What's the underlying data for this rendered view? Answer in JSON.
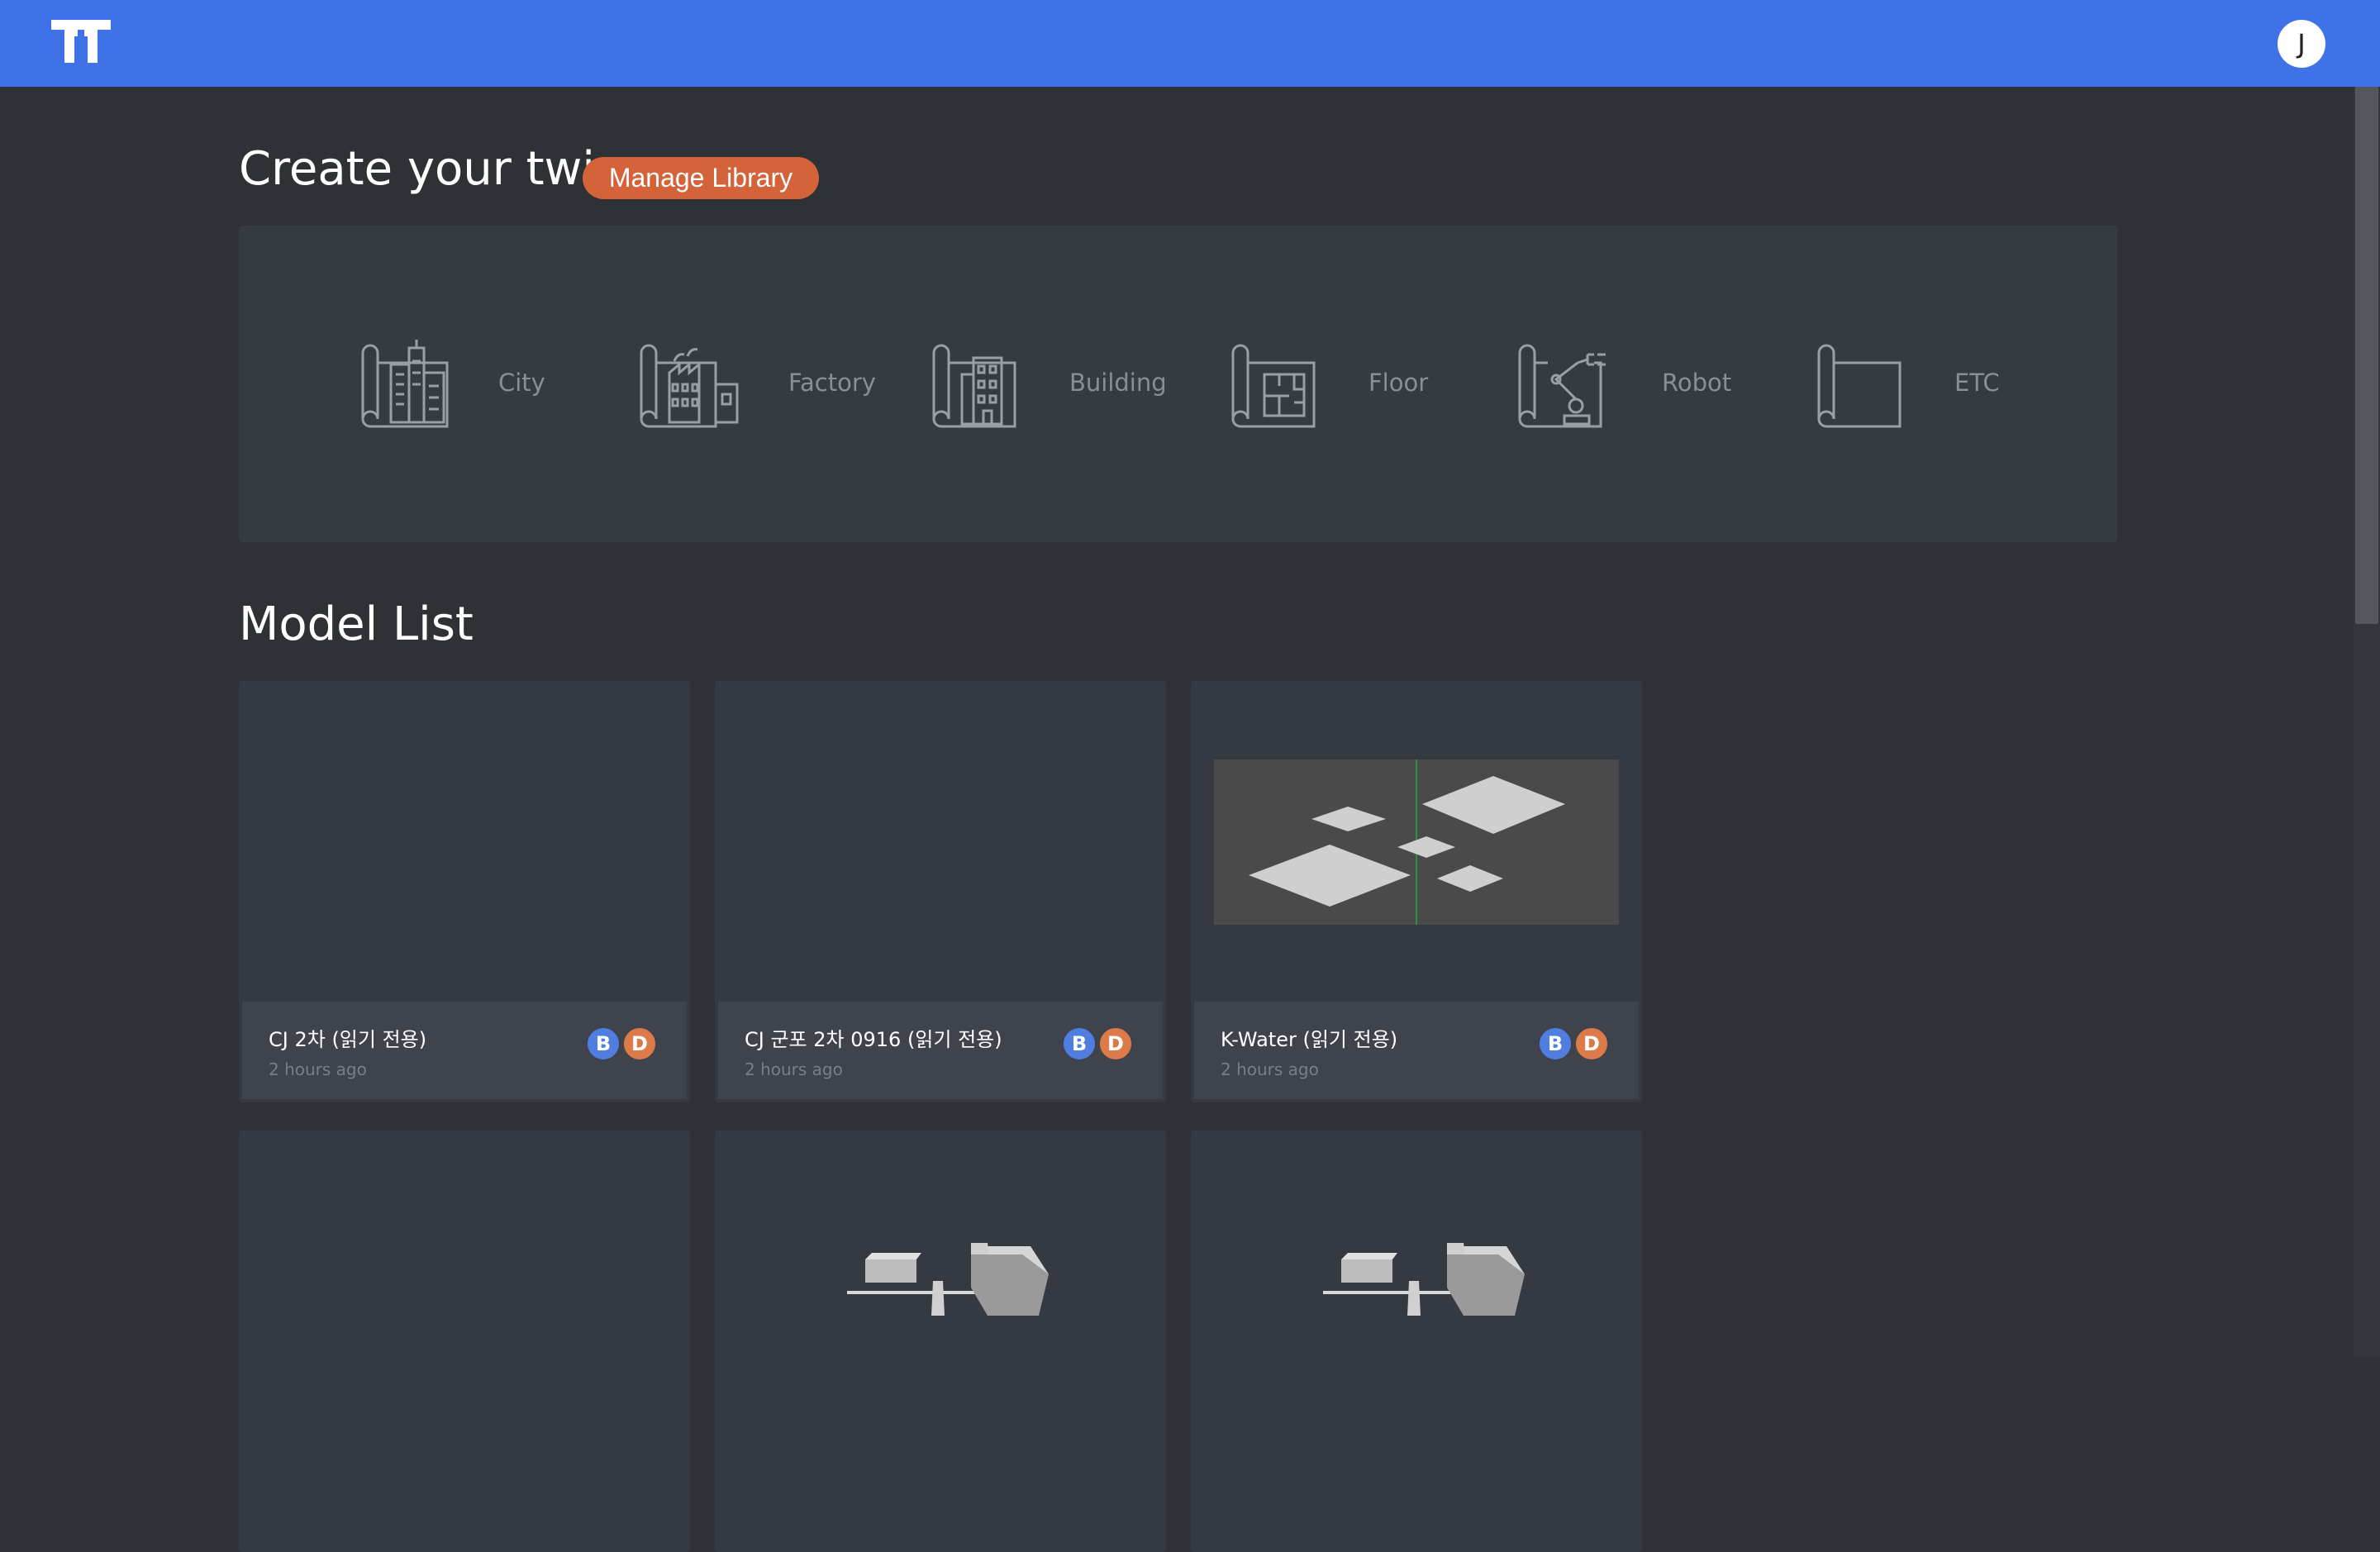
{
  "header": {
    "logo_icon": "twin-logo-icon",
    "avatar_initial": "J",
    "brand_color": "#3f72e6"
  },
  "create": {
    "title": "Create your twin",
    "manage_button": "Manage Library",
    "types": [
      {
        "label": "City",
        "icon": "city-icon"
      },
      {
        "label": "Factory",
        "icon": "factory-icon"
      },
      {
        "label": "Building",
        "icon": "building-icon"
      },
      {
        "label": "Floor",
        "icon": "floor-icon"
      },
      {
        "label": "Robot",
        "icon": "robot-icon"
      },
      {
        "label": "ETC",
        "icon": "etc-icon"
      }
    ]
  },
  "models": {
    "title": "Model List",
    "items": [
      {
        "name": "CJ 2차 (읽기 전용)",
        "time": "2 hours ago",
        "badges": [
          "B",
          "D"
        ]
      },
      {
        "name": "CJ 군포 2차 0916 (읽기 전용)",
        "time": "2 hours ago",
        "badges": [
          "B",
          "D"
        ]
      },
      {
        "name": "K-Water (읽기 전용)",
        "time": "2 hours ago",
        "badges": [
          "B",
          "D"
        ]
      },
      {
        "name": "",
        "time": "",
        "badges": []
      },
      {
        "name": "",
        "time": "",
        "badges": []
      },
      {
        "name": "",
        "time": "",
        "badges": []
      }
    ]
  }
}
